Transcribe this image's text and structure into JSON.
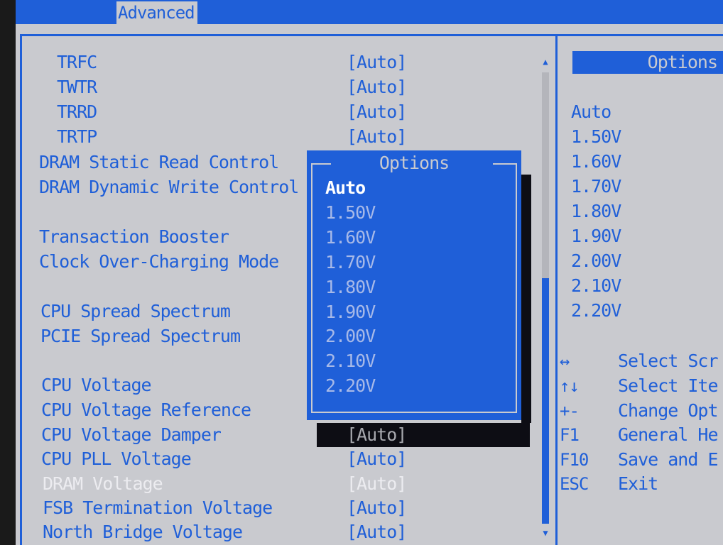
{
  "tabs": {
    "active": "Advanced"
  },
  "settings": [
    {
      "label": "TRFC",
      "value": "[Auto]"
    },
    {
      "label": "TWTR",
      "value": "[Auto]"
    },
    {
      "label": "TRRD",
      "value": "[Auto]"
    },
    {
      "label": "TRTP",
      "value": "[Auto]"
    },
    {
      "label": "DRAM Static Read Control",
      "value": ""
    },
    {
      "label": "DRAM Dynamic Write Control",
      "value": ""
    },
    {
      "label": "Transaction Booster",
      "value": ""
    },
    {
      "label": "Clock Over-Charging Mode",
      "value": ""
    },
    {
      "label": "CPU Spread Spectrum",
      "value": ""
    },
    {
      "label": "PCIE Spread Spectrum",
      "value": ""
    },
    {
      "label": "CPU Voltage",
      "value": ""
    },
    {
      "label": "CPU Voltage Reference",
      "value": ""
    },
    {
      "label": "CPU Voltage Damper",
      "value": "[Auto]"
    },
    {
      "label": "CPU PLL Voltage",
      "value": "[Auto]"
    },
    {
      "label": "DRAM Voltage",
      "value": "[Auto]"
    },
    {
      "label": "FSB Termination Voltage",
      "value": "[Auto]"
    },
    {
      "label": "North Bridge Voltage",
      "value": "[Auto]"
    }
  ],
  "popup": {
    "title": "Options",
    "items": [
      "Auto",
      "1.50V",
      "1.60V",
      "1.70V",
      "1.80V",
      "1.90V",
      "2.00V",
      "2.10V",
      "2.20V"
    ],
    "selected": "Auto"
  },
  "side_panel": {
    "header": "Options",
    "items": [
      "Auto",
      "1.50V",
      "1.60V",
      "1.70V",
      "1.80V",
      "1.90V",
      "2.00V",
      "2.10V",
      "2.20V"
    ]
  },
  "keys": [
    {
      "key": "↔",
      "desc": "Select Scr"
    },
    {
      "key": "↑↓",
      "desc": "Select Ite"
    },
    {
      "key": "+-",
      "desc": "Change Opt"
    },
    {
      "key": "F1",
      "desc": "General He"
    },
    {
      "key": "F10",
      "desc": "Save and E"
    },
    {
      "key": "ESC",
      "desc": "Exit"
    }
  ],
  "colors": {
    "accent": "#1f5fd8",
    "background": "#c9cacf",
    "highlight": "#0d0d14"
  }
}
